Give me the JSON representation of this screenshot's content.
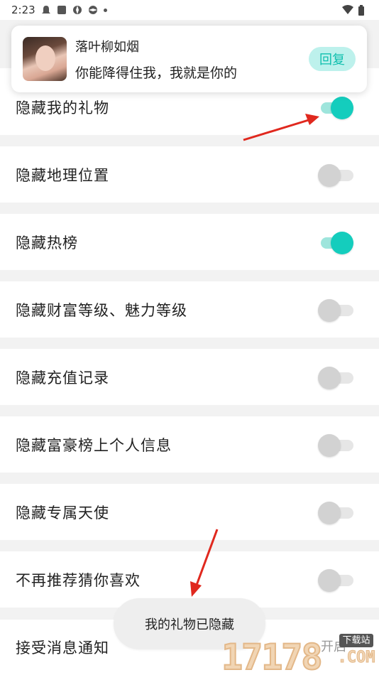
{
  "status_bar": {
    "time": "2:23",
    "left_icons": [
      "ghost-icon",
      "app-square-icon",
      "shutter-icon",
      "shutter-icon",
      "dot-icon"
    ],
    "right_icons": [
      "wifi-icon",
      "battery-icon"
    ]
  },
  "notification": {
    "sender": "落叶柳如烟",
    "message": "你能降得住我，我就是你的",
    "reply_label": "回复"
  },
  "settings": [
    {
      "label": "隐藏我的礼物",
      "on": true
    },
    {
      "label": "隐藏地理位置",
      "on": false
    },
    {
      "label": "隐藏热榜",
      "on": true
    },
    {
      "label": "隐藏财富等级、魅力等级",
      "on": false
    },
    {
      "label": "隐藏充值记录",
      "on": false
    },
    {
      "label": "隐藏富豪榜上个人信息",
      "on": false
    },
    {
      "label": "隐藏专属天使",
      "on": false
    },
    {
      "label": "不再推荐猜你喜欢",
      "on": false
    }
  ],
  "last_row": {
    "label": "接受消息通知",
    "value": "开启"
  },
  "toast": "我的礼物已隐藏",
  "watermark": {
    "number": "17178",
    "tag": "下载站",
    "com": ".COM"
  },
  "colors": {
    "accent": "#14cdbd",
    "accent_track": "#9ee5dc",
    "arrow": "#e0281e"
  }
}
